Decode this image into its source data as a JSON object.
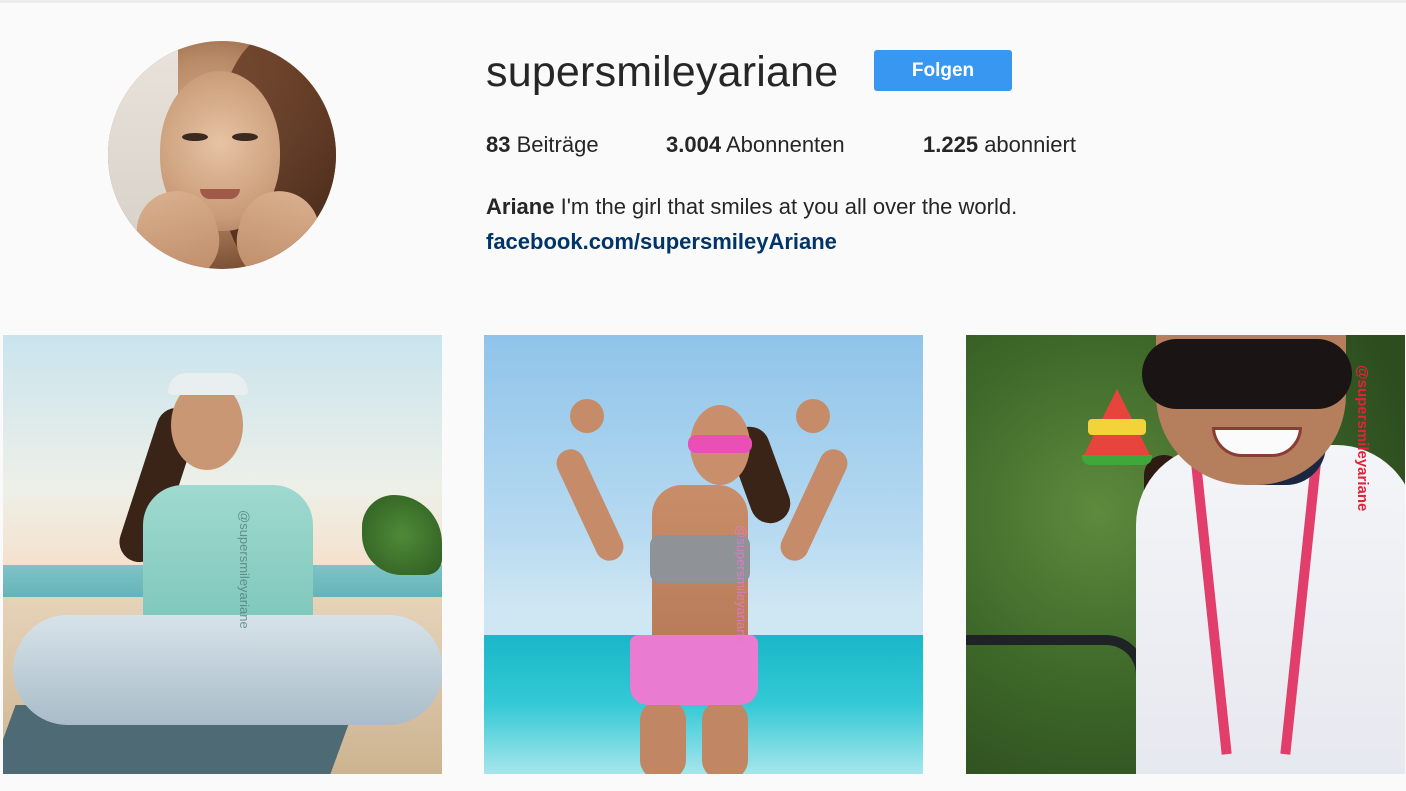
{
  "profile": {
    "username": "supersmileyariane",
    "follow_label": "Folgen",
    "stats": [
      {
        "count": "83",
        "label": "Beiträge"
      },
      {
        "count": "3.004",
        "label": "Abonnenten"
      },
      {
        "count": "1.225",
        "label": "abonniert"
      }
    ],
    "bio_name": "Ariane",
    "bio_text": "I'm the girl that smiles at you all over the world.",
    "bio_link": "facebook.com/supersmileyAriane"
  },
  "posts": [
    {
      "watermark": "@supersmileyariane"
    },
    {
      "watermark": "@supersmileyariane"
    },
    {
      "watermark": "@supersmileyariane"
    }
  ],
  "colors": {
    "follow_button": "#3897f0",
    "link": "#003569",
    "background": "#fafafa"
  }
}
